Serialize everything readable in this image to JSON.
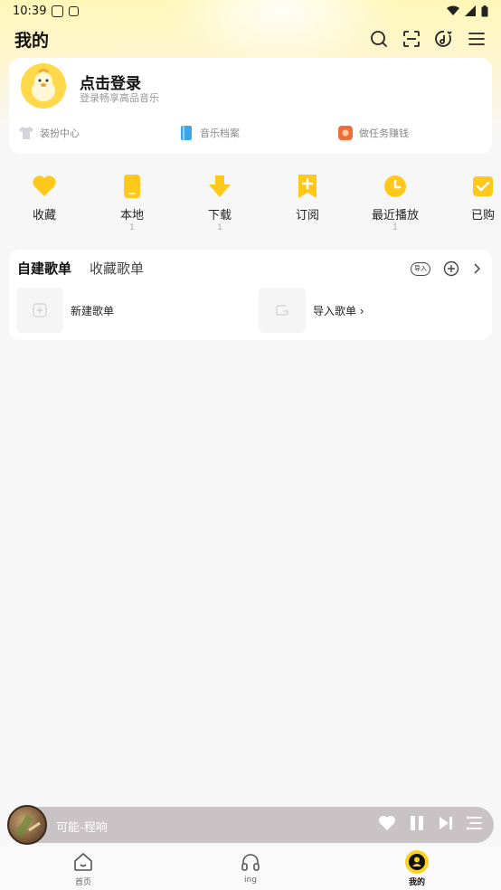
{
  "status_bar": {
    "time": "10:39"
  },
  "header": {
    "title": "我的"
  },
  "profile": {
    "login_title": "点击登录",
    "login_subtitle": "登录畅享高品音乐",
    "links": [
      {
        "label": "装扮中心",
        "icon": "shirt-icon",
        "color": "#c9c9d6"
      },
      {
        "label": "音乐档案",
        "icon": "book-icon",
        "color": "#3aa6e8"
      },
      {
        "label": "做任务赚钱",
        "icon": "redpacket-icon",
        "color": "#f26b3a"
      }
    ]
  },
  "quick_actions": [
    {
      "label": "收藏",
      "count": "",
      "icon": "heart-icon"
    },
    {
      "label": "本地",
      "count": "1",
      "icon": "phone-icon"
    },
    {
      "label": "下载",
      "count": "1",
      "icon": "download-icon"
    },
    {
      "label": "订阅",
      "count": "",
      "icon": "subscribe-icon"
    },
    {
      "label": "最近播放",
      "count": "1",
      "icon": "clock-icon"
    },
    {
      "label": "已购",
      "count": "",
      "icon": "purchased-icon"
    }
  ],
  "playlists": {
    "tabs": [
      "自建歌单",
      "收藏歌单"
    ],
    "import_badge": "导入",
    "items": [
      {
        "label": "新建歌单"
      },
      {
        "label": "导入歌单 ›"
      }
    ]
  },
  "mini_player": {
    "title": "可能-程响"
  },
  "bottom_nav": [
    {
      "label": "首页",
      "icon": "home-icon"
    },
    {
      "label": "ing",
      "icon": "headphones-icon"
    },
    {
      "label": "我的",
      "icon": "profile-icon"
    }
  ],
  "accent_color": "#ffd21e"
}
